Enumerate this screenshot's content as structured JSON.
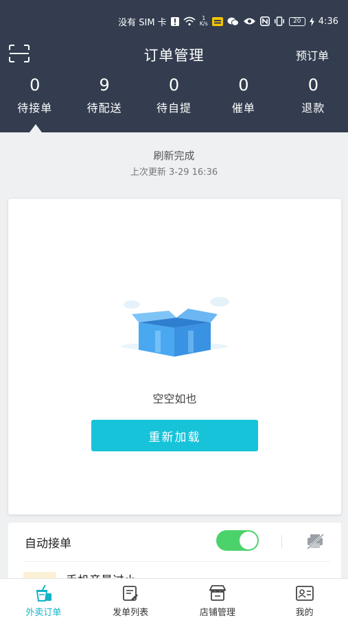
{
  "status_bar": {
    "carrier": "没有 SIM 卡",
    "net_speed_value": "1",
    "net_speed_unit": "K/s",
    "battery": "20",
    "time": "4:36"
  },
  "header": {
    "title": "订单管理",
    "preorder": "预订单",
    "stats": [
      {
        "count": "0",
        "label": "待接单"
      },
      {
        "count": "9",
        "label": "待配送"
      },
      {
        "count": "0",
        "label": "待自提"
      },
      {
        "count": "0",
        "label": "催单"
      },
      {
        "count": "0",
        "label": "退款"
      }
    ],
    "active_stat": "待接单"
  },
  "refresh": {
    "status": "刷新完成",
    "last_update": "上次更新 3-29 16:36"
  },
  "empty_state": {
    "message": "空空如也",
    "reload_label": "重新加载"
  },
  "auto_accept": {
    "label": "自动接单",
    "enabled": true,
    "volume_warning": "手机音量过小"
  },
  "tabbar": {
    "tabs": [
      {
        "label": "外卖订单",
        "icon": "takeout-drink-icon",
        "active": true
      },
      {
        "label": "发单列表",
        "icon": "dispatch-list-icon",
        "active": false
      },
      {
        "label": "店铺管理",
        "icon": "store-icon",
        "active": false
      },
      {
        "label": "我的",
        "icon": "profile-card-icon",
        "active": false
      }
    ]
  },
  "colors": {
    "header_bg": "#333d4f",
    "accent": "#17c3d9",
    "toggle_on": "#4cd26b",
    "active_tab": "#12b3c9"
  }
}
